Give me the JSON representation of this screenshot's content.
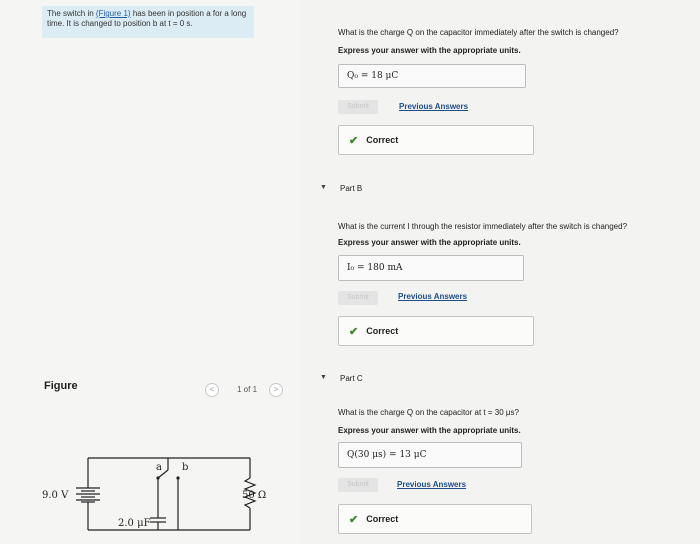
{
  "problem": {
    "text_prefix": "The switch in ",
    "figure_link": "(Figure 1)",
    "text_suffix": " has been in position a for a long time. It is changed to position b at t = 0 s."
  },
  "figure": {
    "label": "Figure",
    "pager": {
      "prev": "<",
      "count": "1 of 1",
      "next": ">"
    },
    "battery_label": "9.0 V",
    "capacitor_label": "2.0 μF",
    "resistor_label": "50 Ω",
    "switch_a": "a",
    "switch_b": "b"
  },
  "partA": {
    "question": "What is the charge Q on the capacitor immediately after the switch is changed?",
    "instruction": "Express your answer with the appropriate units.",
    "answer": "Q₀ = 18 μC",
    "submit": "Submit",
    "previous": "Previous Answers",
    "status": "Correct"
  },
  "partB": {
    "title": "Part B",
    "question": "What is the current I through the resistor immediately after the switch is changed?",
    "instruction": "Express your answer with the appropriate units.",
    "answer": "I₀ = 180 mA",
    "submit": "Submit",
    "previous": "Previous Answers",
    "status": "Correct"
  },
  "partC": {
    "title": "Part C",
    "question": "What is the charge Q on the capacitor at t = 30 μs?",
    "instruction": "Express your answer with the appropriate units.",
    "answer": "Q(30 μs) = 13 μC",
    "submit": "Submit",
    "previous": "Previous Answers",
    "status": "Correct"
  },
  "colors": {
    "accent_link": "#1f4d8a",
    "check_green": "#3b8a2a",
    "problem_bg": "#dcecf4"
  }
}
